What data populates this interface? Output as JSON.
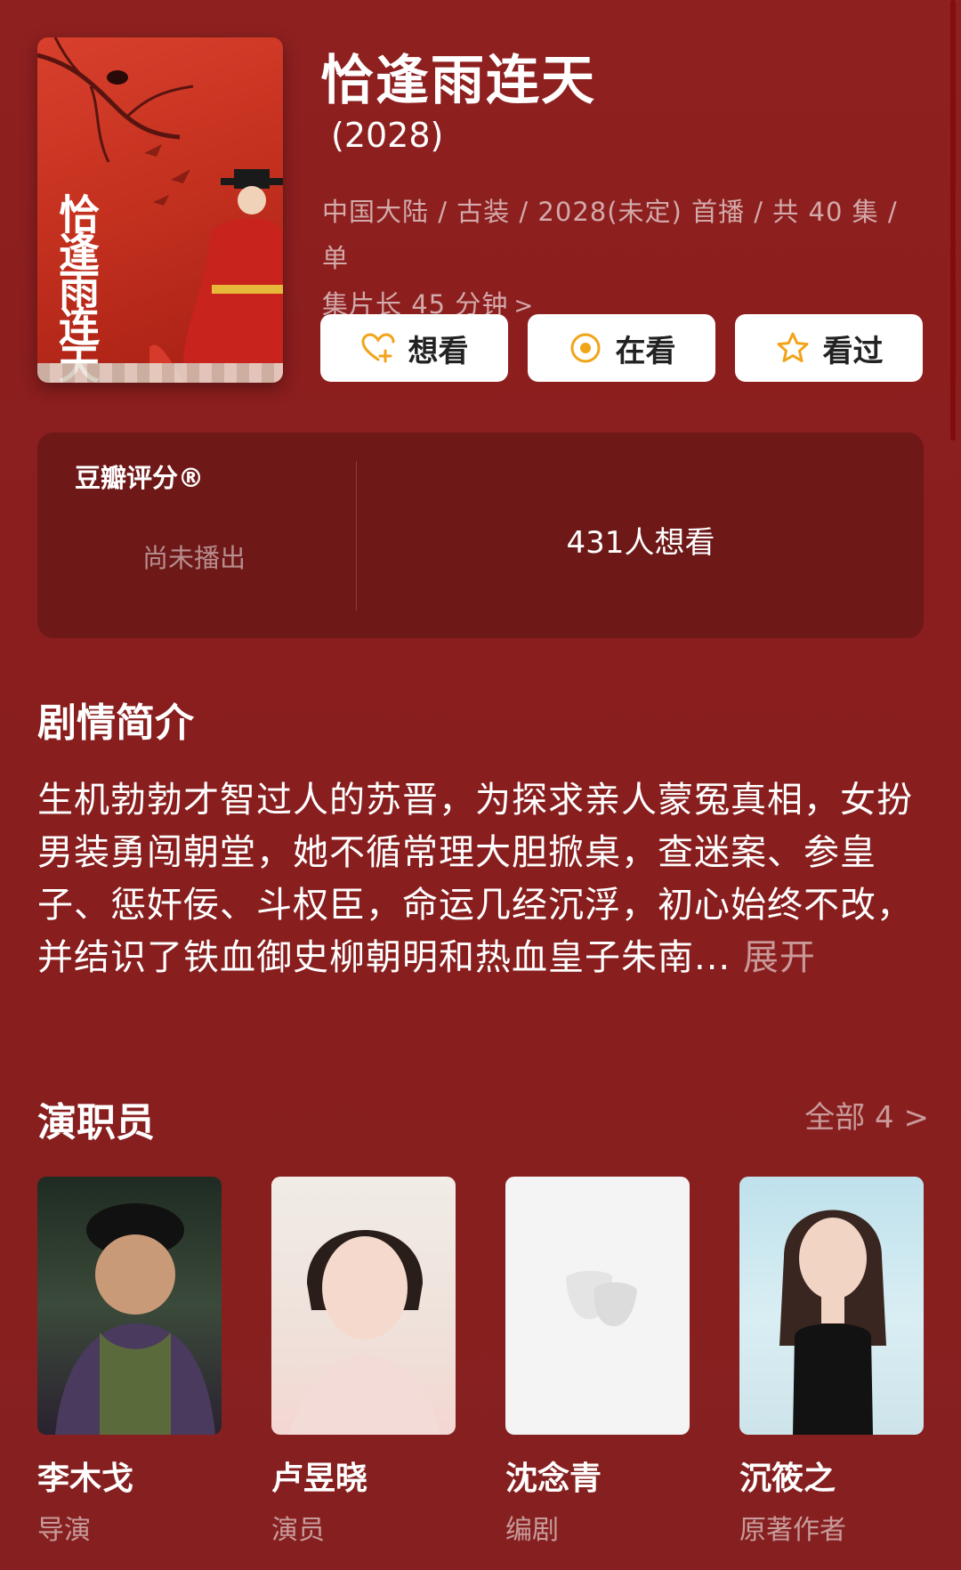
{
  "title": "恰逢雨连天",
  "year": "(2028)",
  "meta": {
    "line1": "中国大陆 / 古装 / 2028(未定) 首播 / 共 40 集 / 单",
    "line2": "集片长 45 分钟"
  },
  "poster": {
    "title_text": "恰逢雨连天"
  },
  "actions": [
    {
      "label": "想看",
      "icon": "heart-plus-icon"
    },
    {
      "label": "在看",
      "icon": "circle-dot-icon"
    },
    {
      "label": "看过",
      "icon": "star-icon"
    }
  ],
  "rating": {
    "label": "豆瓣评分®",
    "status": "尚未播出",
    "wish_count": "431人想看"
  },
  "synopsis": {
    "title": "剧情简介",
    "text": "生机勃勃才智过人的苏晋，为探求亲人蒙冤真相，女扮男装勇闯朝堂，她不循常理大胆掀桌，查迷案、参皇子、惩奸佞、斗权臣，命运几经沉浮，初心始终不改，并结识了铁血御史柳朝明和热血皇子朱南...",
    "expand": "展开"
  },
  "cast": {
    "title": "演职员",
    "all_label": "全部 4",
    "members": [
      {
        "name": "李木戈",
        "role": "导演"
      },
      {
        "name": "卢昱晓",
        "role": "演员"
      },
      {
        "name": "沈念青",
        "role": "编剧"
      },
      {
        "name": "沉筱之",
        "role": "原著作者"
      }
    ]
  },
  "colors": {
    "background": "#8a1f1f",
    "card": "#6e1818",
    "accent_orange": "#f2a419"
  }
}
